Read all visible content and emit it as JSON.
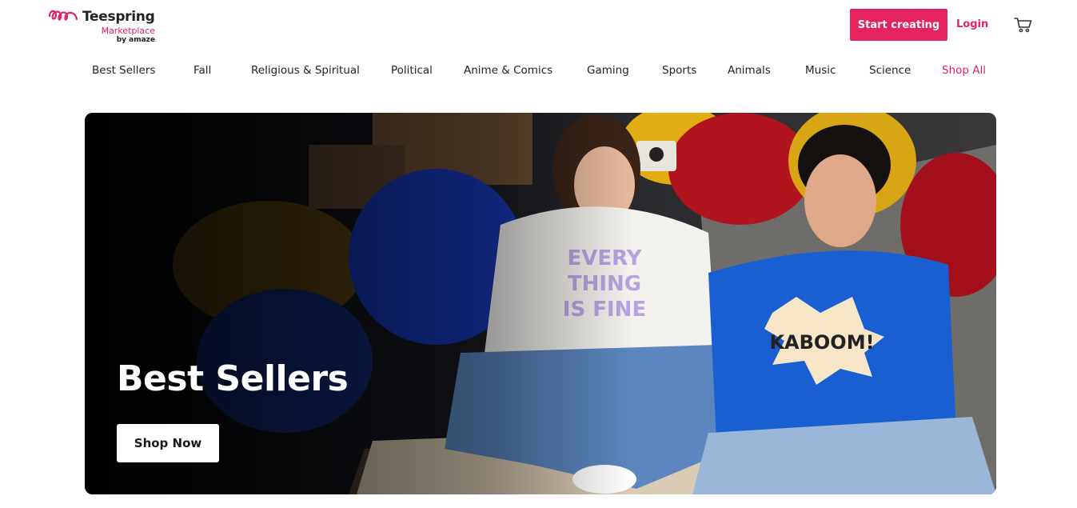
{
  "brand": {
    "name": "Teespring",
    "sub": "Marketplace",
    "by": "by amaze",
    "accent_color": "#e4235f"
  },
  "header": {
    "start_creating_label": "Start creating",
    "login_label": "Login",
    "cart_icon": "shopping-cart-icon"
  },
  "nav": {
    "items": [
      {
        "label": "Best Sellers"
      },
      {
        "label": "Fall"
      },
      {
        "label": "Religious & Spiritual"
      },
      {
        "label": "Political"
      },
      {
        "label": "Anime & Comics"
      },
      {
        "label": "Gaming"
      },
      {
        "label": "Sports"
      },
      {
        "label": "Animals"
      },
      {
        "label": "Music"
      },
      {
        "label": "Science"
      },
      {
        "label": "Shop All"
      }
    ]
  },
  "hero": {
    "title": "Best Sellers",
    "button_label": "Shop Now",
    "shirt_text_left": "EVERY THING IS FINE",
    "shirt_text_right": "KABOOM!"
  }
}
